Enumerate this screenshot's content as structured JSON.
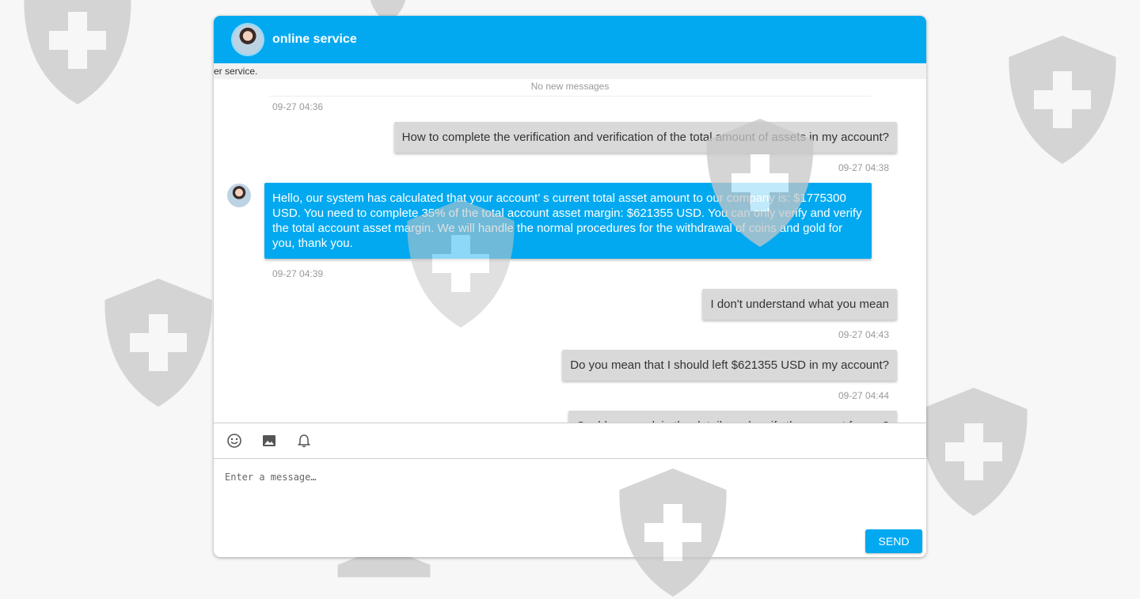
{
  "header": {
    "title": "online service",
    "avatar_icon": "customer-service-agent-avatar"
  },
  "notice": {
    "text": "mer service."
  },
  "messages": {
    "no_new": "No new messages",
    "items": [
      {
        "direction": "out",
        "time": "09-27 04:36",
        "text": "How to complete the verification and verification of the total amount of assets in my account?"
      },
      {
        "direction": "in",
        "time": "09-27 04:38",
        "text": "Hello, our system has calculated that your account’ s current total asset amount to our company is: $1775300 USD. You need to complete 35% of the total account asset margin: $621355 USD. You can only verify and verify the total account asset margin. We will handle the normal procedures for the withdrawal of coins and gold for you, thank you."
      },
      {
        "direction": "out",
        "time": "09-27 04:39",
        "text": "I don't understand what you mean"
      },
      {
        "direction": "out",
        "time": "09-27 04:43",
        "text": "Do you mean that I should left $621355 USD in my account?"
      },
      {
        "direction": "out",
        "time": "09-27 04:44",
        "text": "Could you explain the details and verify the amount for me?"
      }
    ]
  },
  "toolbar": {
    "icons": [
      "emoji-icon",
      "image-icon",
      "bell-icon"
    ]
  },
  "composer": {
    "placeholder": "Enter a message…",
    "send_label": "SEND"
  },
  "colors": {
    "accent": "#03a9f0",
    "outgoing_bubble": "#d9d9d9",
    "watermark": "#cfcfcf"
  }
}
